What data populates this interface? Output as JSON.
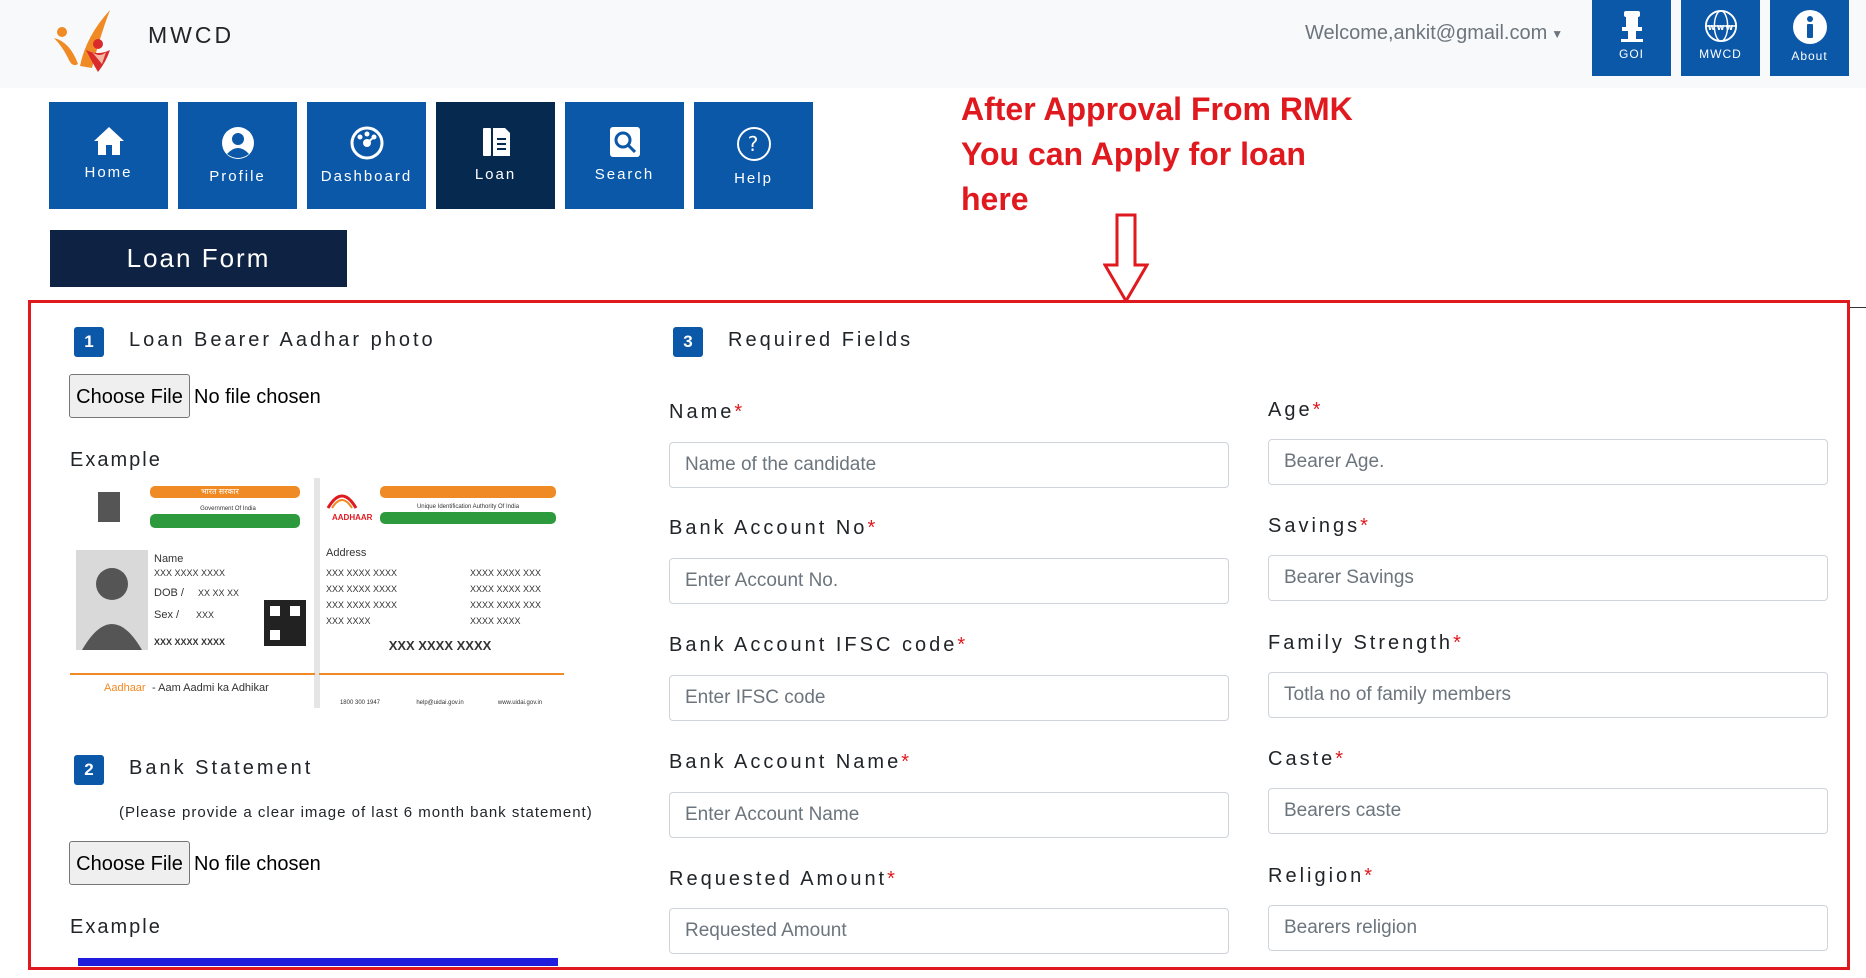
{
  "header": {
    "brand": "MWCD",
    "welcome": "Welcome,ankit@gmail.com",
    "buttons": [
      {
        "label": "GOI",
        "icon": "emblem-icon"
      },
      {
        "label": "MWCD",
        "icon": "globe-www-icon"
      },
      {
        "label": "About",
        "icon": "info-icon"
      }
    ]
  },
  "nav": [
    {
      "label": "Home",
      "icon": "home-icon"
    },
    {
      "label": "Profile",
      "icon": "user-icon"
    },
    {
      "label": "Dashboard",
      "icon": "dashboard-icon"
    },
    {
      "label": "Loan",
      "icon": "document-icon",
      "active": true
    },
    {
      "label": "Search",
      "icon": "search-icon"
    },
    {
      "label": "Help",
      "icon": "help-icon"
    }
  ],
  "annotation": {
    "line1": "After Approval From RMK",
    "line2": "You can Apply for loan",
    "line3": "here"
  },
  "form": {
    "title": "Loan Form",
    "section1": {
      "num": "1",
      "title": "Loan Bearer Aadhar photo",
      "choose": "Choose File",
      "nofile": "No file chosen",
      "example": "Example"
    },
    "section2": {
      "num": "2",
      "title": "Bank Statement",
      "note": "(Please provide a clear image of last 6 month bank statement)",
      "choose": "Choose File",
      "nofile": "No file chosen",
      "example": "Example"
    },
    "section3": {
      "num": "3",
      "title": "Required Fields"
    },
    "fields_left": [
      {
        "label": "Name",
        "placeholder": "Name of the candidate"
      },
      {
        "label": "Bank Account No",
        "placeholder": "Enter Account No."
      },
      {
        "label": "Bank Account IFSC code",
        "placeholder": "Enter IFSC code"
      },
      {
        "label": "Bank Account Name",
        "placeholder": "Enter Account Name"
      },
      {
        "label": "Requested Amount",
        "placeholder": "Requested Amount"
      }
    ],
    "fields_right": [
      {
        "label": "Age",
        "placeholder": "Bearer Age."
      },
      {
        "label": "Savings",
        "placeholder": "Bearer Savings"
      },
      {
        "label": "Family Strength",
        "placeholder": "Totla no of family members"
      },
      {
        "label": "Caste",
        "placeholder": "Bearers caste"
      },
      {
        "label": "Religion",
        "placeholder": "Bearers religion"
      }
    ],
    "required_mark": "*"
  },
  "aadhaar_example": {
    "gov_title": "Government Of India",
    "uidai": "Unique Identification Authority Of India",
    "name": "Name",
    "name_val": "XXX XXXX XXXX",
    "dob": "DOB /",
    "dob_val": "XX XX XX",
    "sex": "Sex /",
    "sex_val": "XXX",
    "number": "XXX XXXX XXXX",
    "address": "Address",
    "addr_lines": [
      "XXX XXXX XXXX",
      "XXX XXXX XXXX",
      "XXX XXXX XXXX",
      "XXX XXXX"
    ],
    "addr_lines2": [
      "XXXX XXXX XXX",
      "XXXX XXXX XXX",
      "XXXX XXXX XXX",
      "XXXX XXXX"
    ],
    "back_number": "XXX XXXX XXXX",
    "tagline_brand": "Aadhaar",
    "tagline_rest": " - Aam Aadmi ka Adhikar",
    "aadhaar_logo": "AADHAAR",
    "hindi": "भारत सरकार",
    "footer_phone": "1800 300 1947",
    "footer_email": "help@uidai.gov.in",
    "footer_web": "www.uidai.gov.in"
  },
  "colors": {
    "primary": "#0b57a8",
    "active": "#062a4f",
    "annotation": "#e0191f",
    "form_title": "#0e2244"
  }
}
